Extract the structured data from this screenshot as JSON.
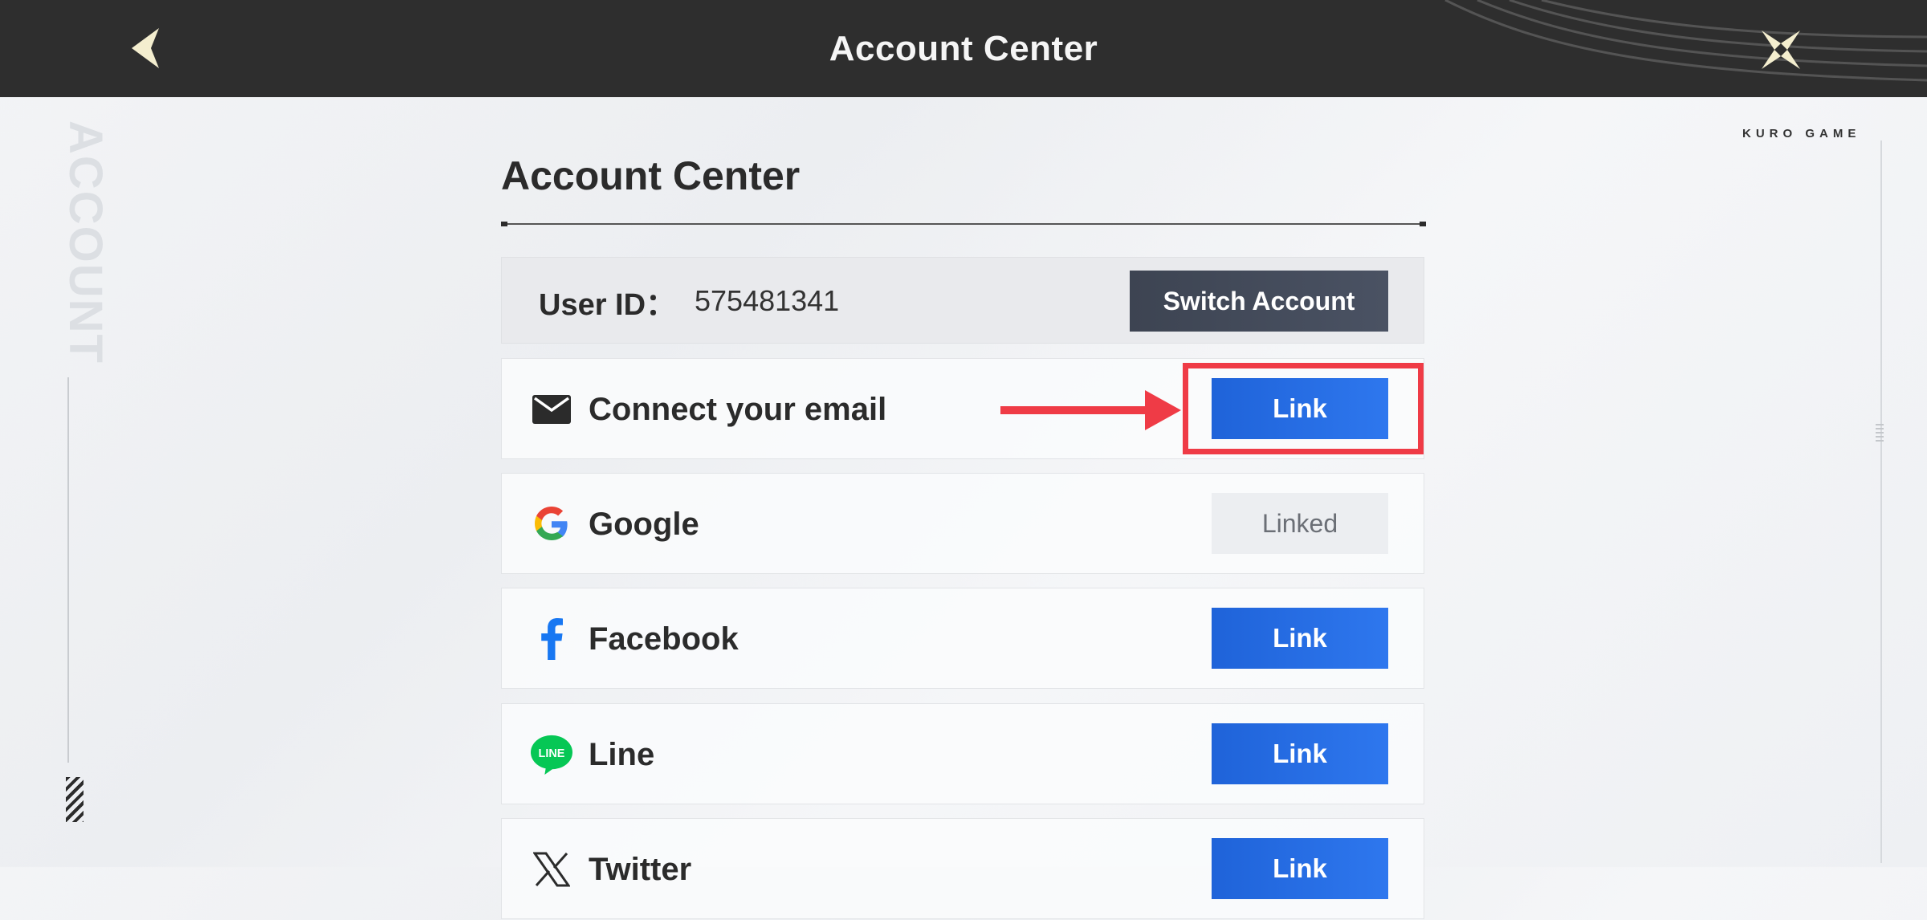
{
  "header": {
    "title": "Account Center",
    "back_icon": "chevron-left-icon",
    "close_icon": "close-x-icon"
  },
  "decor": {
    "side_text": "ACCOUNT",
    "brand": "KURO GAME"
  },
  "main": {
    "heading": "Account Center",
    "user": {
      "label": "User ID：",
      "value": "575481341",
      "switch_label": "Switch Account"
    },
    "providers": [
      {
        "name": "Connect your email",
        "icon": "email-icon",
        "action_label": "Link",
        "status": "link"
      },
      {
        "name": "Google",
        "icon": "google-icon",
        "action_label": "Linked",
        "status": "linked"
      },
      {
        "name": "Facebook",
        "icon": "facebook-icon",
        "action_label": "Link",
        "status": "link"
      },
      {
        "name": "Line",
        "icon": "line-icon",
        "action_label": "Link",
        "status": "link"
      },
      {
        "name": "Twitter",
        "icon": "x-twitter-icon",
        "action_label": "Link",
        "status": "link"
      }
    ]
  },
  "colors": {
    "topbar": "#2e2e2e",
    "link_button": "#1f63d9",
    "switch_button": "#3d4452",
    "highlight": "#ef3b46"
  }
}
